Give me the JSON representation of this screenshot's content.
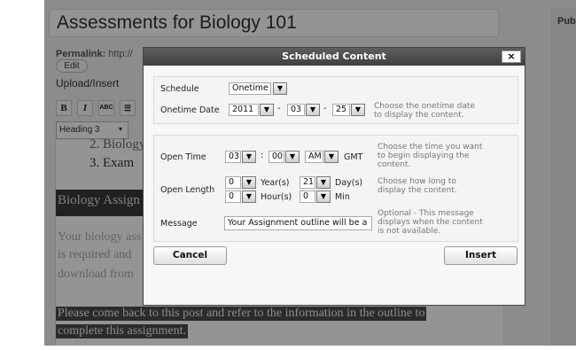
{
  "background": {
    "post_title": "Assessments for Biology 101",
    "permalink_label": "Permalink:",
    "permalink_value": "http://",
    "edit_label": "Edit",
    "upload_insert_label": "Upload/Insert",
    "format_select_value": "Heading 3",
    "sidebar_label": "Pub",
    "editor": {
      "list_items": [
        "2. Biology",
        "3. Exam"
      ],
      "heading": "Biology Assign",
      "lines": [
        "Your biology ass",
        "is required and",
        "download from"
      ],
      "closing_line_1": "Please come back to this post and refer to the information in the outline to",
      "closing_line_2": "complete this assignment."
    },
    "toolbar": {
      "bold": "B",
      "italic": "I",
      "strike": "ABC"
    }
  },
  "dialog": {
    "title": "Scheduled Content",
    "close_label": "×",
    "schedule": {
      "label": "Schedule",
      "value": "Onetime"
    },
    "onetime_date": {
      "label": "Onetime Date",
      "year": "2011",
      "month": "03",
      "day": "25",
      "separator": "-",
      "help_line_1": "Choose the onetime date",
      "help_line_2": "to display the content."
    },
    "open_time": {
      "label": "Open Time",
      "hour": "03",
      "minute": "00",
      "colon": ":",
      "ampm": "AM",
      "timezone": "GMT",
      "help_line_1": "Choose the time you want",
      "help_line_2": "to begin displaying the",
      "help_line_3": "content."
    },
    "open_length": {
      "label": "Open Length",
      "years_value": "0",
      "years_unit": "Year(s)",
      "days_value": "21",
      "days_unit": "Day(s)",
      "hours_value": "0",
      "hours_unit": "Hour(s)",
      "minutes_value": "0",
      "minutes_unit": "Min",
      "help_line_1": "Choose how long to",
      "help_line_2": "display the content."
    },
    "message": {
      "label": "Message",
      "value": "Your Assignment outline will be a",
      "help_line_1": "Optional - This message",
      "help_line_2": "displays when the content",
      "help_line_3": "is not available."
    },
    "cancel_label": "Cancel",
    "insert_label": "Insert",
    "dropdown_arrow": "▼"
  }
}
